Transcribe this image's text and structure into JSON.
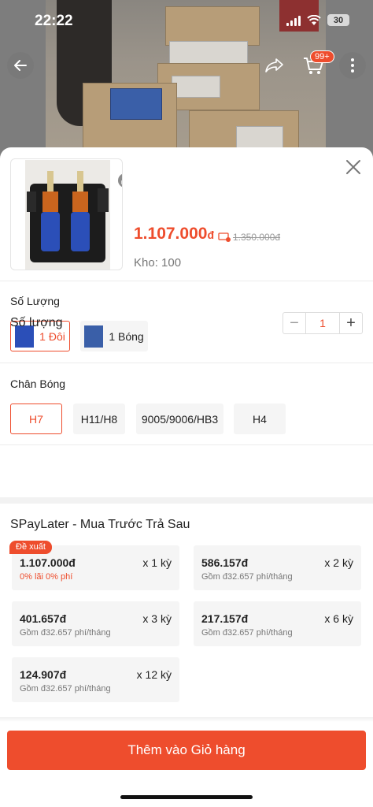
{
  "status_bar": {
    "time": "22:22",
    "battery": "30"
  },
  "nav": {
    "cart_badge": "99+"
  },
  "product": {
    "price": "1.107.000",
    "price_currency": "đ",
    "old_price": "1.350.000đ",
    "stock": "Kho: 100"
  },
  "variant_section": {
    "label": "Số Lượng",
    "options": [
      {
        "label": "1 Đôi",
        "selected": true
      },
      {
        "label": "1 Bóng",
        "selected": false
      }
    ]
  },
  "socket_section": {
    "label": "Chân Bóng",
    "options": [
      {
        "label": "H7",
        "selected": true
      },
      {
        "label": "H11/H8",
        "selected": false
      },
      {
        "label": "9005/9006/HB3",
        "selected": false
      },
      {
        "label": "H4",
        "selected": false
      }
    ]
  },
  "quantity": {
    "label": "Số lượng",
    "value": "1"
  },
  "spaylater": {
    "title": "SPayLater - Mua Trước Trả Sau",
    "recommended_badge": "Đề xuất",
    "plans": [
      {
        "amount": "1.107.000đ",
        "term": "x 1 kỳ",
        "note": "0% lãi 0% phí"
      },
      {
        "amount": "586.157đ",
        "term": "x 2 kỳ",
        "note": "Gồm đ32.657 phí/tháng"
      },
      {
        "amount": "401.657đ",
        "term": "x 3 kỳ",
        "note": "Gồm đ32.657 phí/tháng"
      },
      {
        "amount": "217.157đ",
        "term": "x 6 kỳ",
        "note": "Gồm đ32.657 phí/tháng"
      },
      {
        "amount": "124.907đ",
        "term": "x 12 kỳ",
        "note": "Gồm đ32.657 phí/tháng"
      }
    ]
  },
  "add_to_cart_label": "Thêm vào Giỏ hàng",
  "colors": {
    "accent": "#ee4d2d"
  }
}
